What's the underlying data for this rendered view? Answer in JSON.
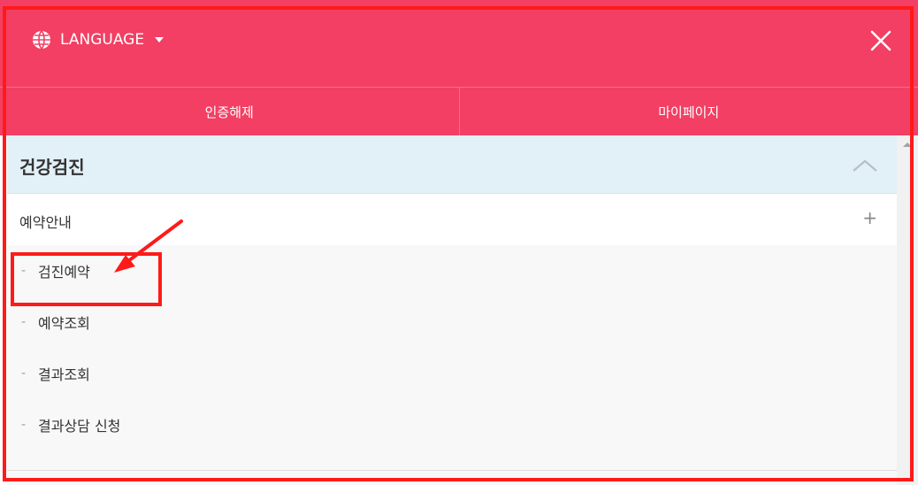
{
  "header": {
    "language_label": "LANGUAGE",
    "language_icon": "globe-icon",
    "caret_icon": "caret-down-icon",
    "close_icon": "close-icon",
    "bg_color": "#f23f63"
  },
  "auth_bar": {
    "logout_label": "인증해제",
    "mypage_label": "마이페이지"
  },
  "menu": {
    "section_title": "건강검진",
    "section_expanded": true,
    "section_icon": "chevron-up-icon",
    "sub_title": "예약안내",
    "sub_icon": "plus-icon",
    "sub_plus": "+",
    "item_dash": "-",
    "items": [
      {
        "label": "검진예약",
        "highlighted": true
      },
      {
        "label": "예약조회",
        "highlighted": false
      },
      {
        "label": "결과조회",
        "highlighted": false
      },
      {
        "label": "결과상담 신청",
        "highlighted": false
      }
    ]
  },
  "annotation": {
    "color": "#ff1a1a",
    "arrow_icon": "red-arrow-icon",
    "highlight_target": "검진예약"
  }
}
